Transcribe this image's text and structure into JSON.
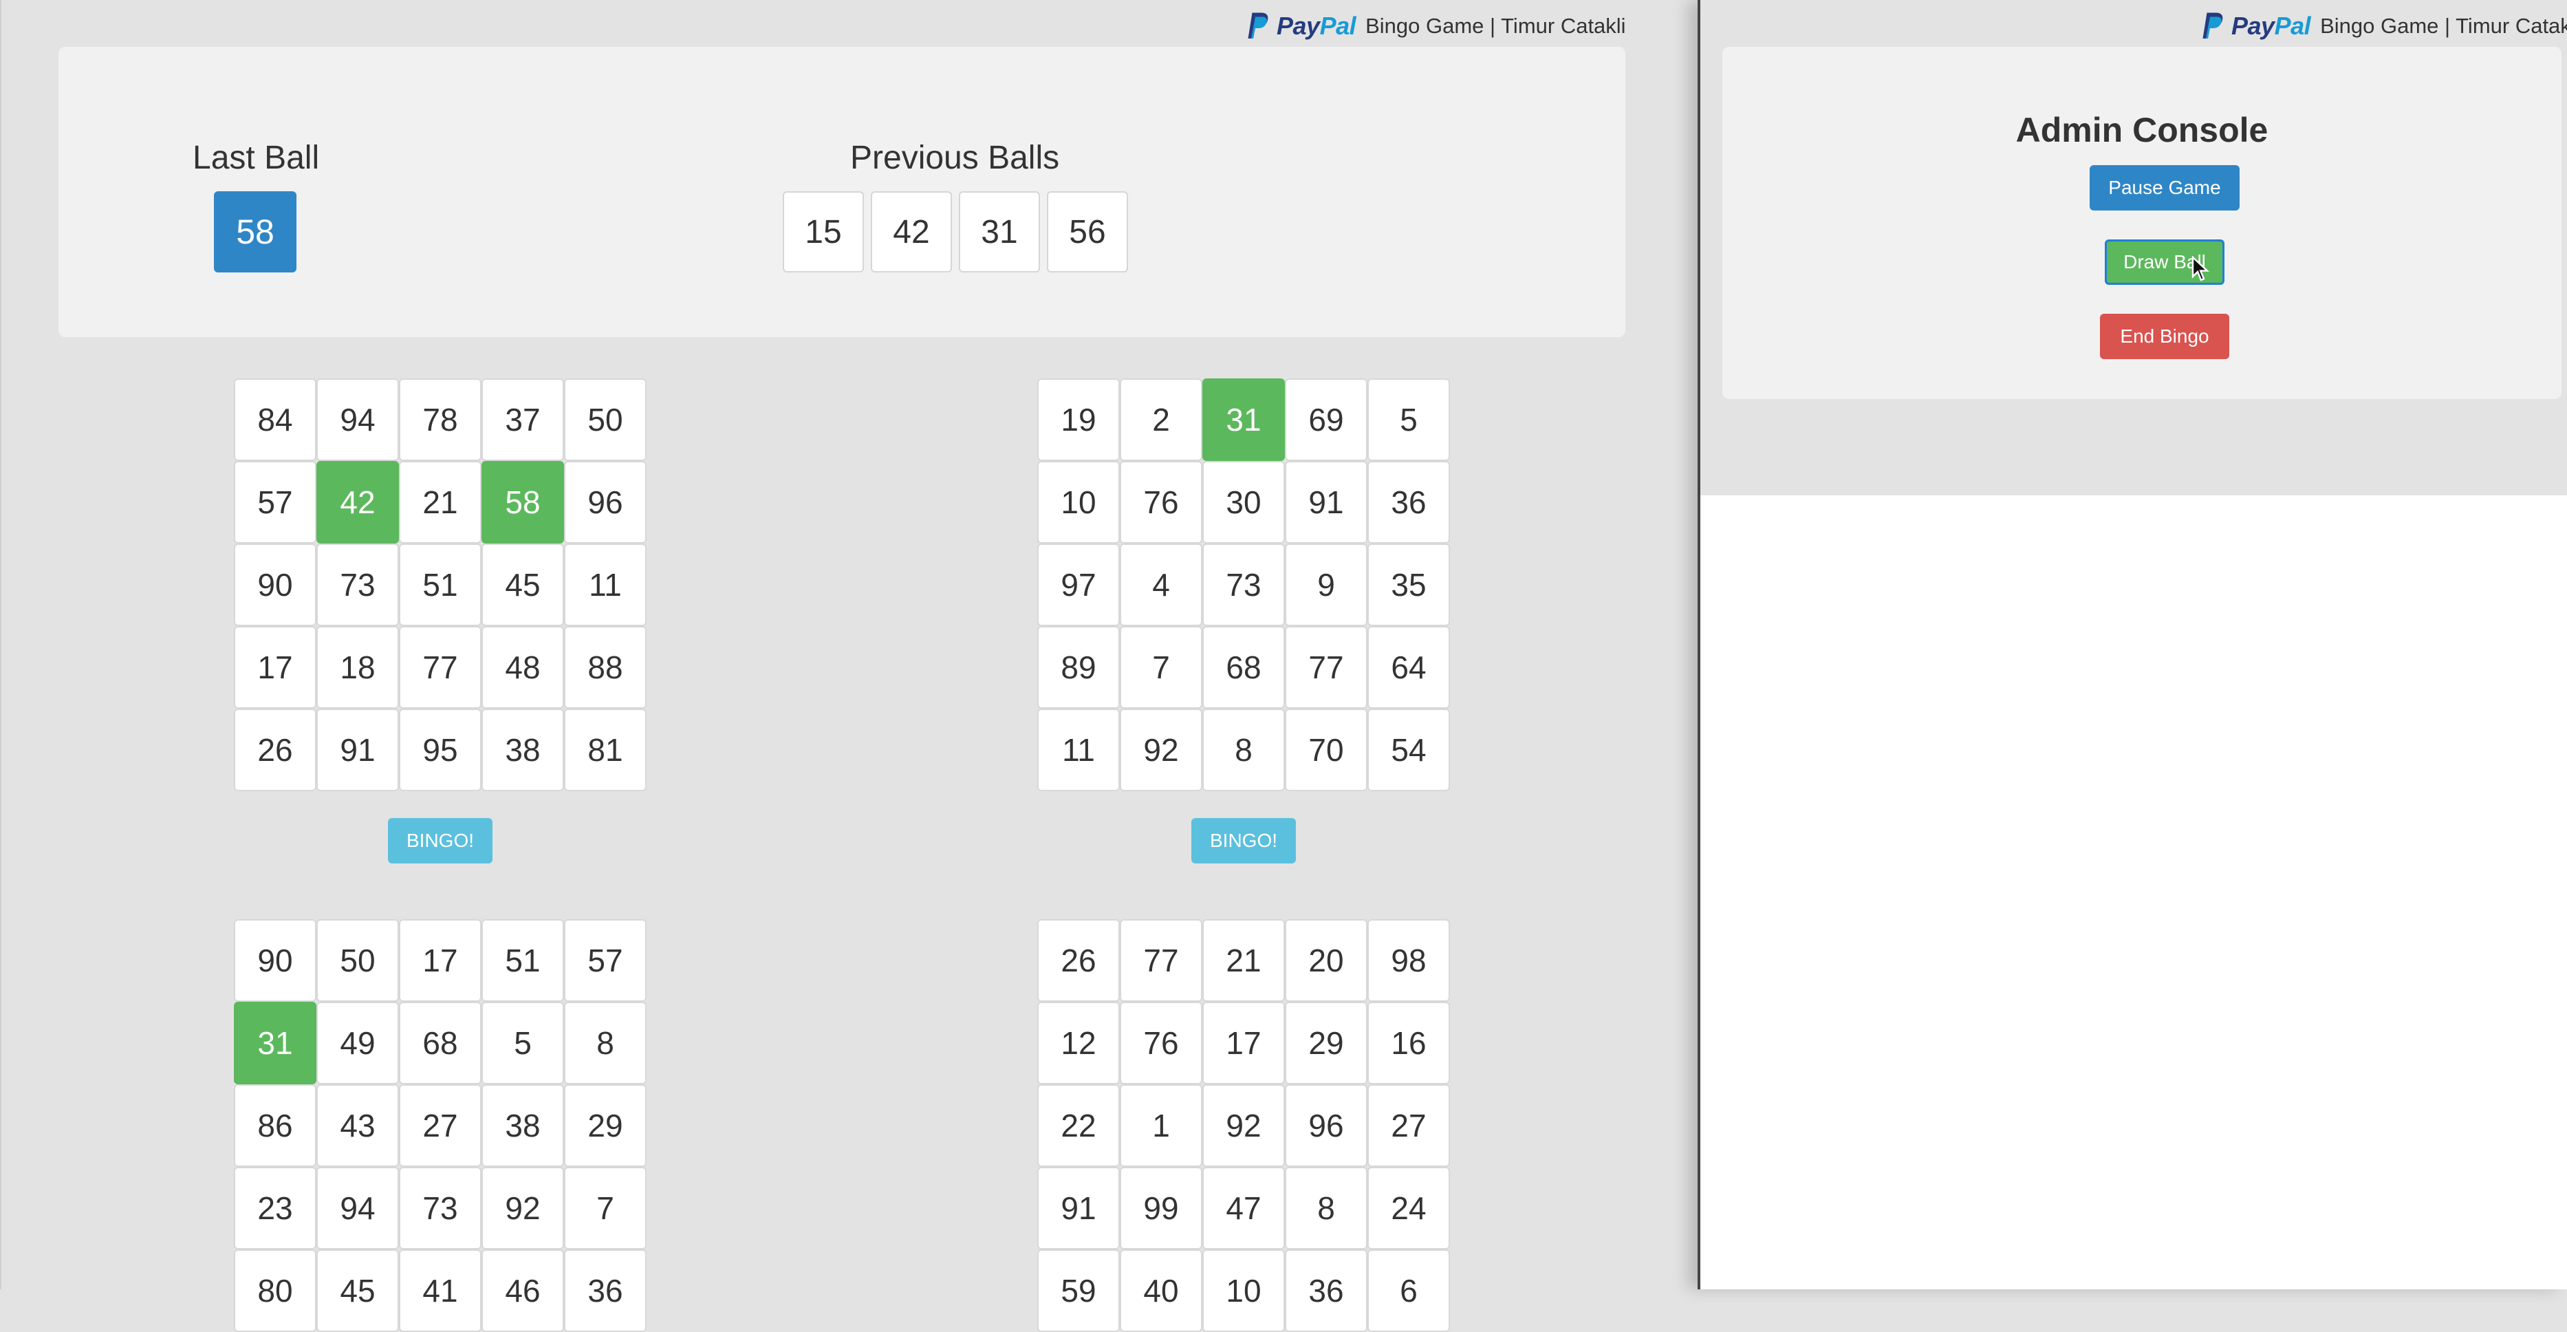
{
  "header": {
    "brand": "PayPal",
    "brand_pay": "Pay",
    "brand_pal": "Pal",
    "title": "Bingo Game | Timur Catakli"
  },
  "balls": {
    "last_label": "Last Ball",
    "last_value": "58",
    "previous_label": "Previous Balls",
    "previous": [
      "15",
      "42",
      "31",
      "56"
    ]
  },
  "cards": [
    {
      "cells": [
        "84",
        "94",
        "78",
        "37",
        "50",
        "57",
        "42",
        "21",
        "58",
        "96",
        "90",
        "73",
        "51",
        "45",
        "11",
        "17",
        "18",
        "77",
        "48",
        "88",
        "26",
        "91",
        "95",
        "38",
        "81"
      ],
      "bingo_label": "BINGO!"
    },
    {
      "cells": [
        "19",
        "2",
        "31",
        "69",
        "5",
        "10",
        "76",
        "30",
        "91",
        "36",
        "97",
        "4",
        "73",
        "9",
        "35",
        "89",
        "7",
        "68",
        "77",
        "64",
        "11",
        "92",
        "8",
        "70",
        "54"
      ],
      "bingo_label": "BINGO!"
    },
    {
      "cells": [
        "90",
        "50",
        "17",
        "51",
        "57",
        "31",
        "49",
        "68",
        "5",
        "8",
        "86",
        "43",
        "27",
        "38",
        "29",
        "23",
        "94",
        "73",
        "92",
        "7",
        "80",
        "45",
        "41",
        "46",
        "36"
      ]
    },
    {
      "cells": [
        "26",
        "77",
        "21",
        "20",
        "98",
        "12",
        "76",
        "17",
        "29",
        "16",
        "22",
        "1",
        "92",
        "96",
        "27",
        "91",
        "99",
        "47",
        "8",
        "24",
        "59",
        "40",
        "10",
        "36",
        "6"
      ]
    }
  ],
  "admin": {
    "title": "Admin Console",
    "pause_label": "Pause Game",
    "draw_label": "Draw Ball",
    "end_label": "End Bingo"
  },
  "colors": {
    "accent_blue": "#2f86c6",
    "marked_green": "#5cb85c",
    "bingo_cyan": "#5bc0de",
    "danger_red": "#d9534f"
  }
}
